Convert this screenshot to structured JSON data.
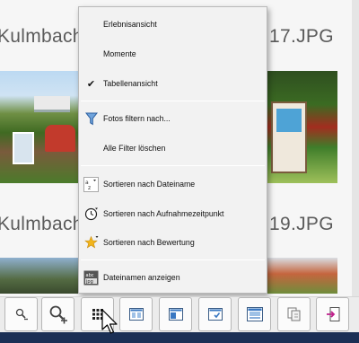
{
  "gallery": {
    "row1_title": "Kulmbach",
    "row1_right_title": "17.JPG",
    "row2_title": "Kulmbach",
    "row2_right_title": "19.JPG"
  },
  "menu": {
    "items": [
      {
        "id": "erlebnisansicht",
        "label": "Erlebnisansicht",
        "checked": false,
        "icon": ""
      },
      {
        "id": "momente",
        "label": "Momente",
        "checked": false,
        "icon": ""
      },
      {
        "id": "tabellenansicht",
        "label": "Tabellenansicht",
        "checked": true,
        "icon": "checkmark-icon"
      },
      {
        "id": "fotos-filtern",
        "label": "Fotos filtern nach...",
        "checked": false,
        "icon": "filter-icon"
      },
      {
        "id": "alle-filter",
        "label": "Alle Filter löschen",
        "checked": false,
        "icon": ""
      },
      {
        "id": "sort-dateiname",
        "label": "Sortieren nach Dateiname",
        "checked": false,
        "icon": "sort-by-filename-icon"
      },
      {
        "id": "sort-aufnahme",
        "label": "Sortieren nach Aufnahmezeitpunkt",
        "checked": false,
        "icon": "clock-icon"
      },
      {
        "id": "sort-bewertung",
        "label": "Sortieren nach Bewertung",
        "checked": false,
        "icon": "star-icon"
      },
      {
        "id": "dateinamen-anzeigen",
        "label": "Dateinamen anzeigen",
        "checked": false,
        "icon": "abc-jpg-icon"
      }
    ],
    "check_glyph": "✔"
  },
  "toolbar": {
    "buttons": [
      {
        "id": "zoom-out",
        "icon": "zoom-out-icon"
      },
      {
        "id": "zoom-in",
        "icon": "zoom-in-icon"
      },
      {
        "id": "view-options",
        "icon": "grid-view-icon"
      },
      {
        "id": "layout-a",
        "icon": "panel-layout-icon"
      },
      {
        "id": "layout-b",
        "icon": "panel-left-icon"
      },
      {
        "id": "layout-c",
        "icon": "panel-check-icon"
      },
      {
        "id": "layout-d",
        "icon": "panel-preview-icon"
      },
      {
        "id": "copy",
        "icon": "copy-icon"
      },
      {
        "id": "export",
        "icon": "export-icon"
      }
    ]
  },
  "colors": {
    "menu_bg": "#f2f2f2",
    "taskbar": "#1b2f55",
    "accent_blue": "#3a78c2",
    "star": "#f2b51c"
  }
}
